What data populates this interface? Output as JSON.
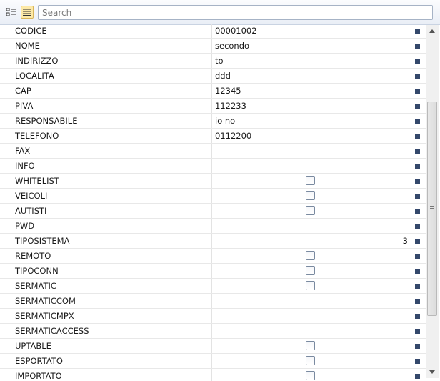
{
  "search": {
    "placeholder": "Search"
  },
  "toolbar": {
    "categorized_icon": "categorized-view-icon",
    "alphabetical_icon": "alphabetical-view-icon"
  },
  "properties": [
    {
      "name": "CODICE",
      "value": "00001002",
      "type": "text"
    },
    {
      "name": "NOME",
      "value": "secondo",
      "type": "text"
    },
    {
      "name": "INDIRIZZO",
      "value": "to",
      "type": "text"
    },
    {
      "name": "LOCALITA",
      "value": "ddd",
      "type": "text"
    },
    {
      "name": "CAP",
      "value": "12345",
      "type": "text"
    },
    {
      "name": "PIVA",
      "value": "112233",
      "type": "text"
    },
    {
      "name": "RESPONSABILE",
      "value": "io no",
      "type": "text"
    },
    {
      "name": "TELEFONO",
      "value": "0112200",
      "type": "text"
    },
    {
      "name": "FAX",
      "value": "",
      "type": "text"
    },
    {
      "name": "INFO",
      "value": "",
      "type": "text"
    },
    {
      "name": "WHITELIST",
      "value": false,
      "type": "checkbox"
    },
    {
      "name": "VEICOLI",
      "value": false,
      "type": "checkbox"
    },
    {
      "name": "AUTISTI",
      "value": false,
      "type": "checkbox"
    },
    {
      "name": "PWD",
      "value": "",
      "type": "text"
    },
    {
      "name": "TIPOSISTEMA",
      "value": "3",
      "type": "number"
    },
    {
      "name": "REMOTO",
      "value": false,
      "type": "checkbox"
    },
    {
      "name": "TIPOCONN",
      "value": false,
      "type": "checkbox"
    },
    {
      "name": "SERMATIC",
      "value": false,
      "type": "checkbox"
    },
    {
      "name": "SERMATICCOM",
      "value": "",
      "type": "text"
    },
    {
      "name": "SERMATICMPX",
      "value": "",
      "type": "text"
    },
    {
      "name": "SERMATICACCESS",
      "value": "",
      "type": "text"
    },
    {
      "name": "UPTABLE",
      "value": false,
      "type": "checkbox"
    },
    {
      "name": "ESPORTATO",
      "value": false,
      "type": "checkbox"
    },
    {
      "name": "IMPORTATO",
      "value": false,
      "type": "checkbox"
    }
  ],
  "colors": {
    "marker": "#34486b",
    "toolbar_top": "#fbfcfe",
    "toolbar_bottom": "#e9eef6",
    "active_button": "#fde9a7"
  }
}
